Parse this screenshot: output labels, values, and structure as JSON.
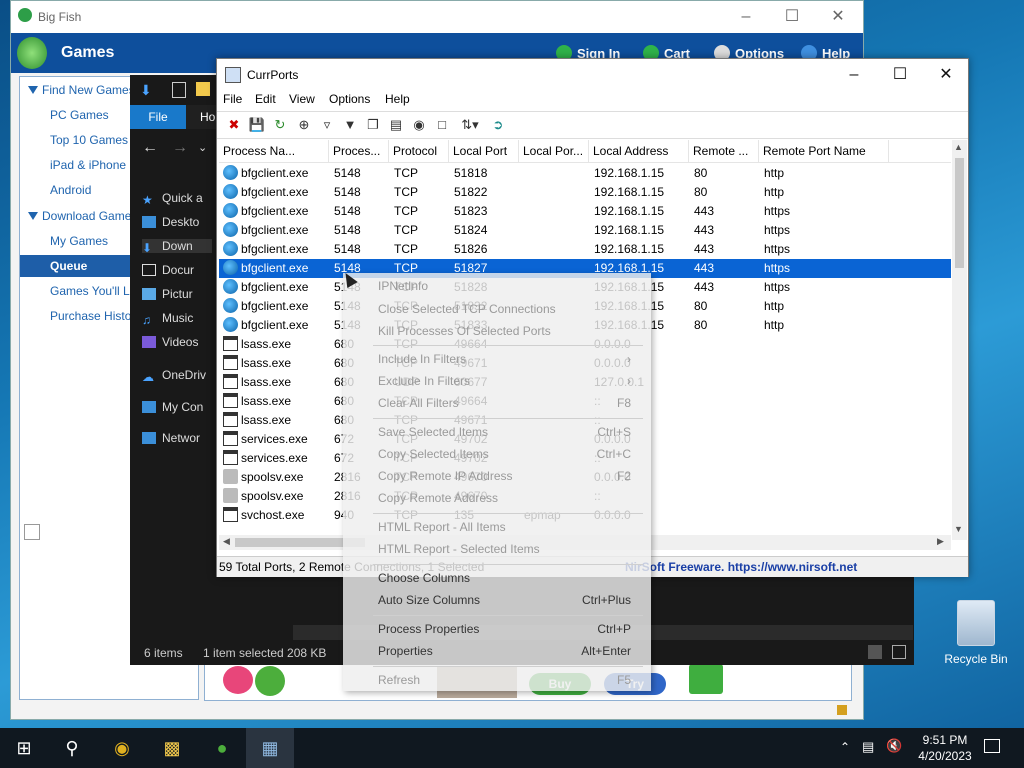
{
  "bigfish": {
    "title": "Big Fish",
    "brand": "Games",
    "links": {
      "signin": "Sign In",
      "cart": "Cart",
      "options": "Options",
      "help": "Help"
    },
    "sidebar": {
      "find_heading": "Find New Games",
      "find_items": [
        "PC Games",
        "Top 10 Games",
        "iPad & iPhone",
        "Android"
      ],
      "download_heading": "Download Games",
      "download_items": [
        "My Games",
        "Queue",
        "Games You'll Love",
        "Purchase History"
      ]
    },
    "buy_label": "Buy",
    "try_label": "Try"
  },
  "explorer": {
    "file_tab": "File",
    "home_tab": "Ho",
    "nav": [
      "Quick a",
      "Deskto",
      "Down",
      "Docur",
      "Pictur",
      "Music",
      "Videos",
      "OneDriv",
      "My Con",
      "Networ"
    ],
    "status_items": "6 items",
    "status_selected": "1 item selected  208 KB"
  },
  "currports": {
    "title": "CurrPorts",
    "menu": [
      "File",
      "Edit",
      "View",
      "Options",
      "Help"
    ],
    "columns": [
      "Process Na...",
      "Proces...",
      "Protocol",
      "Local Port",
      "Local Por...",
      "Local Address",
      "Remote ...",
      "Remote Port Name"
    ],
    "rows": [
      {
        "icon": "globe",
        "name": "bfgclient.exe",
        "pid": "5148",
        "proto": "TCP",
        "lport": "51818",
        "lportname": "",
        "laddr": "192.168.1.15",
        "rport": "80",
        "rportname": "http"
      },
      {
        "icon": "globe",
        "name": "bfgclient.exe",
        "pid": "5148",
        "proto": "TCP",
        "lport": "51822",
        "lportname": "",
        "laddr": "192.168.1.15",
        "rport": "80",
        "rportname": "http"
      },
      {
        "icon": "globe",
        "name": "bfgclient.exe",
        "pid": "5148",
        "proto": "TCP",
        "lport": "51823",
        "lportname": "",
        "laddr": "192.168.1.15",
        "rport": "443",
        "rportname": "https"
      },
      {
        "icon": "globe",
        "name": "bfgclient.exe",
        "pid": "5148",
        "proto": "TCP",
        "lport": "51824",
        "lportname": "",
        "laddr": "192.168.1.15",
        "rport": "443",
        "rportname": "https"
      },
      {
        "icon": "globe",
        "name": "bfgclient.exe",
        "pid": "5148",
        "proto": "TCP",
        "lport": "51826",
        "lportname": "",
        "laddr": "192.168.1.15",
        "rport": "443",
        "rportname": "https"
      },
      {
        "icon": "globe",
        "name": "bfgclient.exe",
        "pid": "5148",
        "proto": "TCP",
        "lport": "51827",
        "lportname": "",
        "laddr": "192.168.1.15",
        "rport": "443",
        "rportname": "https",
        "selected": true
      },
      {
        "icon": "globe",
        "name": "bfgclient.exe",
        "pid": "5148",
        "proto": "TCP",
        "lport": "51828",
        "lportname": "",
        "laddr": "192.168.1.15",
        "rport": "443",
        "rportname": "https"
      },
      {
        "icon": "globe",
        "name": "bfgclient.exe",
        "pid": "5148",
        "proto": "TCP",
        "lport": "51832",
        "lportname": "",
        "laddr": "192.168.1.15",
        "rport": "80",
        "rportname": "http"
      },
      {
        "icon": "globe",
        "name": "bfgclient.exe",
        "pid": "5148",
        "proto": "TCP",
        "lport": "51833",
        "lportname": "",
        "laddr": "192.168.1.15",
        "rport": "80",
        "rportname": "http"
      },
      {
        "icon": "win",
        "name": "lsass.exe",
        "pid": "680",
        "proto": "TCP",
        "lport": "49664",
        "lportname": "",
        "laddr": "0.0.0.0",
        "rport": "",
        "rportname": ""
      },
      {
        "icon": "win",
        "name": "lsass.exe",
        "pid": "680",
        "proto": "TCP",
        "lport": "49671",
        "lportname": "",
        "laddr": "0.0.0.0",
        "rport": "",
        "rportname": ""
      },
      {
        "icon": "win",
        "name": "lsass.exe",
        "pid": "680",
        "proto": "UDP",
        "lport": "60677",
        "lportname": "",
        "laddr": "127.0.0.1",
        "rport": "",
        "rportname": ""
      },
      {
        "icon": "win",
        "name": "lsass.exe",
        "pid": "680",
        "proto": "TCP",
        "lport": "49664",
        "lportname": "",
        "laddr": "::",
        "rport": "",
        "rportname": ""
      },
      {
        "icon": "win",
        "name": "lsass.exe",
        "pid": "680",
        "proto": "TCP",
        "lport": "49671",
        "lportname": "",
        "laddr": "::",
        "rport": "",
        "rportname": ""
      },
      {
        "icon": "win",
        "name": "services.exe",
        "pid": "672",
        "proto": "TCP",
        "lport": "49702",
        "lportname": "",
        "laddr": "0.0.0.0",
        "rport": "",
        "rportname": ""
      },
      {
        "icon": "win",
        "name": "services.exe",
        "pid": "672",
        "proto": "TCP",
        "lport": "49702",
        "lportname": "",
        "laddr": "::",
        "rport": "",
        "rportname": ""
      },
      {
        "icon": "printer",
        "name": "spoolsv.exe",
        "pid": "2816",
        "proto": "TCP",
        "lport": "49670",
        "lportname": "",
        "laddr": "0.0.0.0",
        "rport": "",
        "rportname": ""
      },
      {
        "icon": "printer",
        "name": "spoolsv.exe",
        "pid": "2816",
        "proto": "TCP",
        "lport": "49670",
        "lportname": "",
        "laddr": "::",
        "rport": "",
        "rportname": ""
      },
      {
        "icon": "win",
        "name": "svchost.exe",
        "pid": "940",
        "proto": "TCP",
        "lport": "135",
        "lportname": "epmap",
        "laddr": "0.0.0.0",
        "rport": "",
        "rportname": ""
      }
    ],
    "status_left": "59 Total Ports, 2 Remote Connections, 1 Selected",
    "status_right": "NirSoft Freeware. https://www.nirsoft.net"
  },
  "context_menu": {
    "items": [
      {
        "label": "IPNetInfo",
        "key": "",
        "disabled": true
      },
      {
        "label": "Close Selected TCP Connections",
        "key": "",
        "disabled": true
      },
      {
        "label": "Kill Processes Of Selected Ports",
        "key": "",
        "disabled": true
      },
      {
        "label": "Include In Filters",
        "key": "›",
        "disabled": true
      },
      {
        "label": "Exclude In Filters",
        "key": "›",
        "disabled": true
      },
      {
        "label": "Clear All Filters",
        "key": "F8",
        "disabled": true
      },
      {
        "label": "Save Selected Items",
        "key": "Ctrl+S",
        "disabled": true
      },
      {
        "label": "Copy Selected Items",
        "key": "Ctrl+C",
        "disabled": true
      },
      {
        "label": "Copy Remote IP Address",
        "key": "F2",
        "disabled": true
      },
      {
        "label": "Copy Remote Address",
        "key": "",
        "disabled": true
      },
      {
        "label": "HTML Report - All Items",
        "key": "",
        "disabled": true
      },
      {
        "label": "HTML Report - Selected Items",
        "key": "",
        "disabled": true
      },
      {
        "label": "Choose Columns",
        "key": "",
        "disabled": false
      },
      {
        "label": "Auto Size Columns",
        "key": "Ctrl+Plus",
        "disabled": false
      },
      {
        "label": "Process Properties",
        "key": "Ctrl+P",
        "disabled": false
      },
      {
        "label": "Properties",
        "key": "Alt+Enter",
        "disabled": false
      },
      {
        "label": "Refresh",
        "key": "F5",
        "disabled": true
      }
    ]
  },
  "desktop": {
    "recycle_bin": "Recycle Bin"
  },
  "taskbar": {
    "time": "9:51 PM",
    "date": "4/20/2023"
  }
}
